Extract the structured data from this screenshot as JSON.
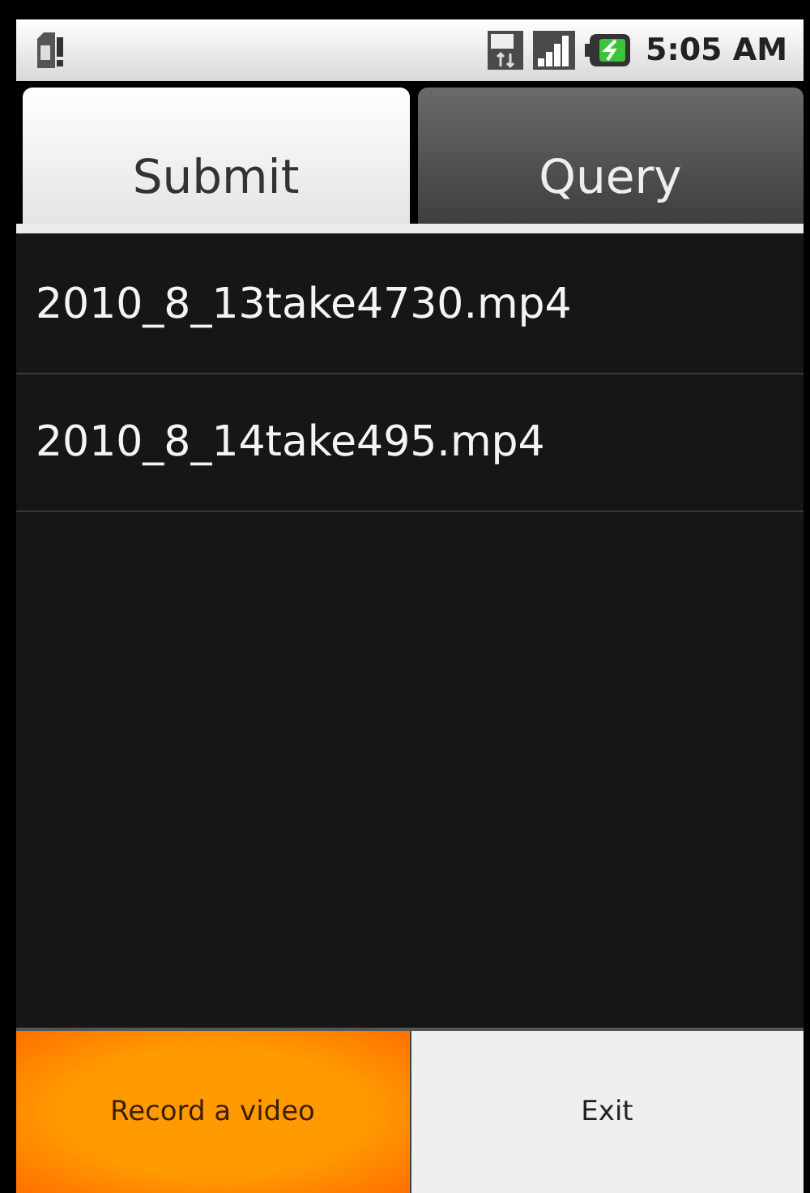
{
  "status_bar": {
    "time": "5:05 AM"
  },
  "tabs": [
    {
      "label": "Submit",
      "selected": true
    },
    {
      "label": "Query",
      "selected": false
    }
  ],
  "files": [
    {
      "name": "2010_8_13take4730.mp4"
    },
    {
      "name": "2010_8_14take495.mp4"
    }
  ],
  "buttons": [
    {
      "label": "Record a video",
      "focused": true
    },
    {
      "label": "Exit",
      "focused": false
    }
  ]
}
